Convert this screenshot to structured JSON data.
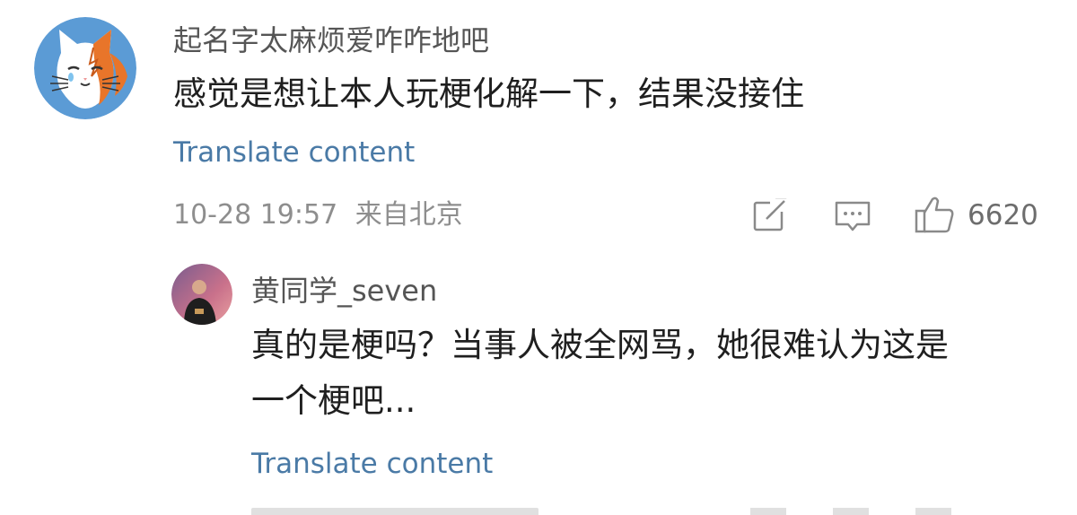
{
  "comments": [
    {
      "username": "起名字太麻烦爱咋咋地吧",
      "text": "感觉是想让本人玩梗化解一下，结果没接住",
      "translate_label": "Translate content",
      "timestamp": "10-28 19:57",
      "location": "来自北京",
      "actions": {
        "share_icon": "share-external-icon",
        "comment_icon": "comment-bubble-icon",
        "like_icon": "thumbs-up-icon",
        "like_count": "6620"
      }
    }
  ],
  "replies": [
    {
      "username": "黄同学_seven",
      "text_line1": "真的是梗吗？当事人被全网骂，她很难认为这是",
      "text_line2": "一个梗吧...",
      "translate_label": "Translate content"
    }
  ],
  "colors": {
    "link": "#4a7aa6",
    "meta": "#8e8e8e",
    "avatar_bg": "#5b9bd5"
  }
}
